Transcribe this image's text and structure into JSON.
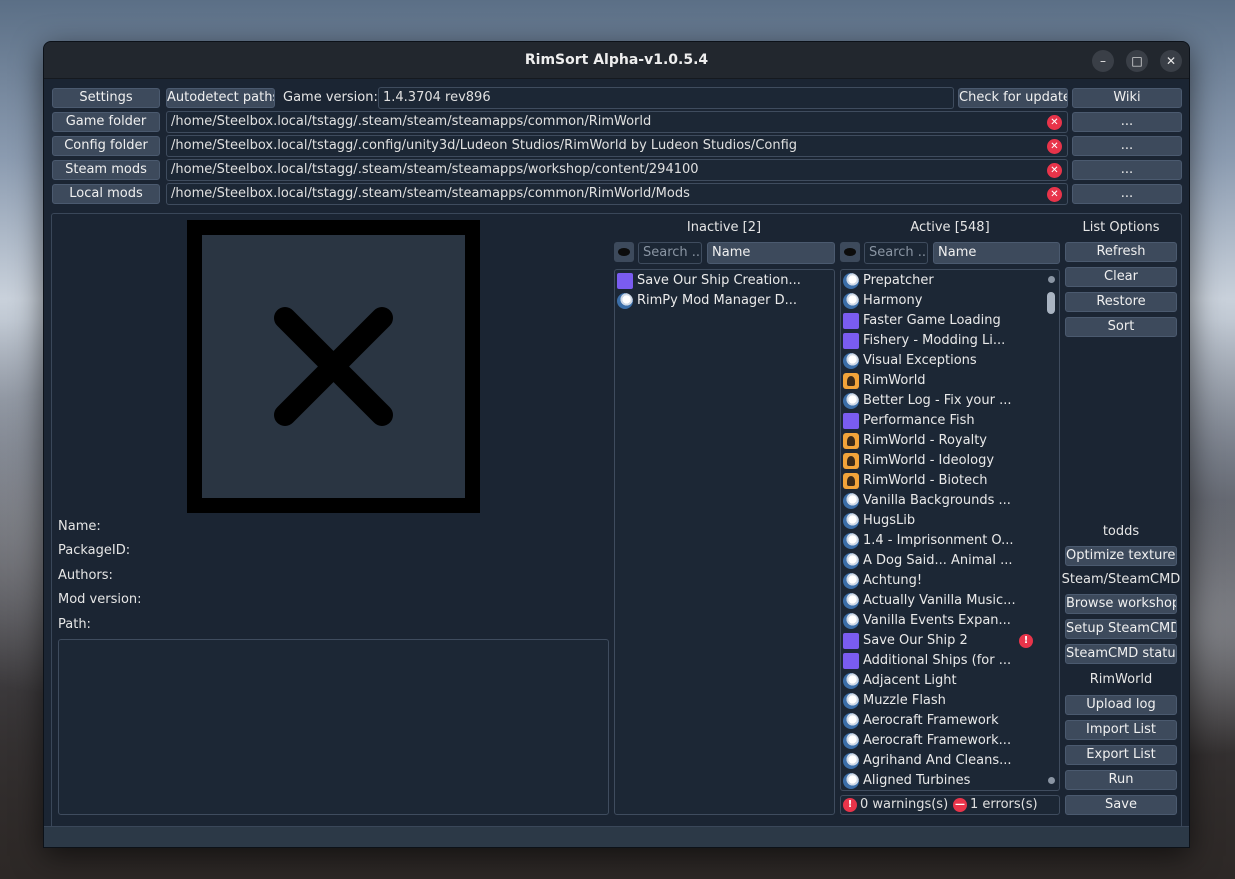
{
  "window": {
    "title": "RimSort Alpha-v1.0.5.4"
  },
  "toolbar": {
    "settings": "Settings",
    "autodetect": "Autodetect paths",
    "game_version_label": "Game version:",
    "game_version_value": "1.4.3704 rev896",
    "check_update": "Check for update",
    "wiki": "Wiki"
  },
  "paths": [
    {
      "button": "Game folder",
      "value": "/home/Steelbox.local/tstagg/.steam/steam/steamapps/common/RimWorld",
      "browse": "..."
    },
    {
      "button": "Config folder",
      "value": "/home/Steelbox.local/tstagg/.config/unity3d/Ludeon Studios/RimWorld by Ludeon Studios/Config",
      "browse": "..."
    },
    {
      "button": "Steam mods",
      "value": "/home/Steelbox.local/tstagg/.steam/steam/steamapps/workshop/content/294100",
      "browse": "..."
    },
    {
      "button": "Local mods",
      "value": "/home/Steelbox.local/tstagg/.steam/steam/steamapps/common/RimWorld/Mods",
      "browse": "..."
    }
  ],
  "mod_info": {
    "name_label": "Name:",
    "package_label": "PackageID:",
    "authors_label": "Authors:",
    "version_label": "Mod version:",
    "path_label": "Path:"
  },
  "inactive": {
    "title": "Inactive [2]",
    "search_placeholder": "Search ...",
    "sort_value": "Name",
    "items": [
      {
        "label": "Save Our Ship Creation...",
        "icon": "local-folder-icon"
      },
      {
        "label": "RimPy Mod Manager D...",
        "icon": "steam-icon"
      }
    ]
  },
  "active": {
    "title": "Active [548]",
    "search_placeholder": "Search ...",
    "sort_value": "Name",
    "items": [
      {
        "label": "Prepatcher",
        "icon": "steam-icon"
      },
      {
        "label": "Harmony",
        "icon": "steam-icon"
      },
      {
        "label": "Faster Game Loading",
        "icon": "local-folder-icon"
      },
      {
        "label": "Fishery - Modding Li...",
        "icon": "local-folder-icon"
      },
      {
        "label": "Visual Exceptions",
        "icon": "steam-icon"
      },
      {
        "label": "RimWorld",
        "icon": "core-icon"
      },
      {
        "label": "Better Log - Fix your ...",
        "icon": "steam-icon"
      },
      {
        "label": "Performance Fish",
        "icon": "local-folder-icon"
      },
      {
        "label": "RimWorld - Royalty",
        "icon": "core-icon"
      },
      {
        "label": "RimWorld - Ideology",
        "icon": "core-icon"
      },
      {
        "label": "RimWorld - Biotech",
        "icon": "core-icon"
      },
      {
        "label": "Vanilla Backgrounds ...",
        "icon": "steam-icon"
      },
      {
        "label": "HugsLib",
        "icon": "steam-icon"
      },
      {
        "label": "1.4 - Imprisonment O...",
        "icon": "steam-icon"
      },
      {
        "label": "A Dog Said... Animal ...",
        "icon": "steam-icon"
      },
      {
        "label": "Achtung!",
        "icon": "steam-icon"
      },
      {
        "label": "Actually Vanilla Music...",
        "icon": "steam-icon"
      },
      {
        "label": "Vanilla Events Expan...",
        "icon": "steam-icon"
      },
      {
        "label": "Save Our Ship 2",
        "icon": "local-folder-icon",
        "warning": true
      },
      {
        "label": "Additional Ships (for ...",
        "icon": "local-folder-icon"
      },
      {
        "label": "Adjacent Light",
        "icon": "steam-icon"
      },
      {
        "label": "Muzzle Flash",
        "icon": "steam-icon"
      },
      {
        "label": "Aerocraft Framework",
        "icon": "steam-icon"
      },
      {
        "label": "Aerocraft Framework...",
        "icon": "steam-icon"
      },
      {
        "label": "Agrihand And Cleans...",
        "icon": "steam-icon"
      },
      {
        "label": "Aligned Turbines",
        "icon": "steam-icon"
      }
    ],
    "warnings": "0 warnings(s)",
    "errors": "1 errors(s)"
  },
  "list_options": {
    "title": "List Options",
    "refresh": "Refresh",
    "clear": "Clear",
    "restore": "Restore",
    "sort": "Sort",
    "todds_title": "todds",
    "optimize": "Optimize textures",
    "steam_title": "Steam/SteamCMD",
    "browse_workshop": "Browse workshop",
    "setup_steamcmd": "Setup SteamCMD",
    "steamcmd_status": "SteamCMD status",
    "rimworld_title": "RimWorld",
    "upload_log": "Upload log",
    "import_list": "Import List",
    "export_list": "Export List",
    "run": "Run",
    "save": "Save"
  },
  "colors": {
    "window_bg": "#1b2533",
    "button_bg": "#3d4a5c",
    "error_red": "#e8344a",
    "local_purple": "#7a5cf0",
    "core_orange": "#f2a43a"
  }
}
